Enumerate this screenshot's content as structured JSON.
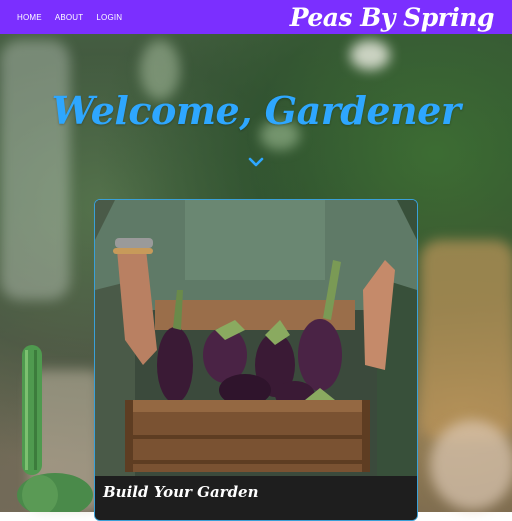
{
  "nav": {
    "items": [
      {
        "label": "HOME"
      },
      {
        "label": "ABOUT"
      },
      {
        "label": "LOGIN"
      }
    ]
  },
  "brand": {
    "title": "Peas By Spring"
  },
  "hero": {
    "heading": "Welcome, Gardener",
    "scroll_icon": "chevron-down-icon"
  },
  "card": {
    "title": "Build Your Garden",
    "image_description_icon": "eggplant-basket-photo"
  },
  "colors": {
    "topbar": "#7b2fff",
    "heading": "#2ea7ff",
    "card_border": "#3aa0d8"
  }
}
